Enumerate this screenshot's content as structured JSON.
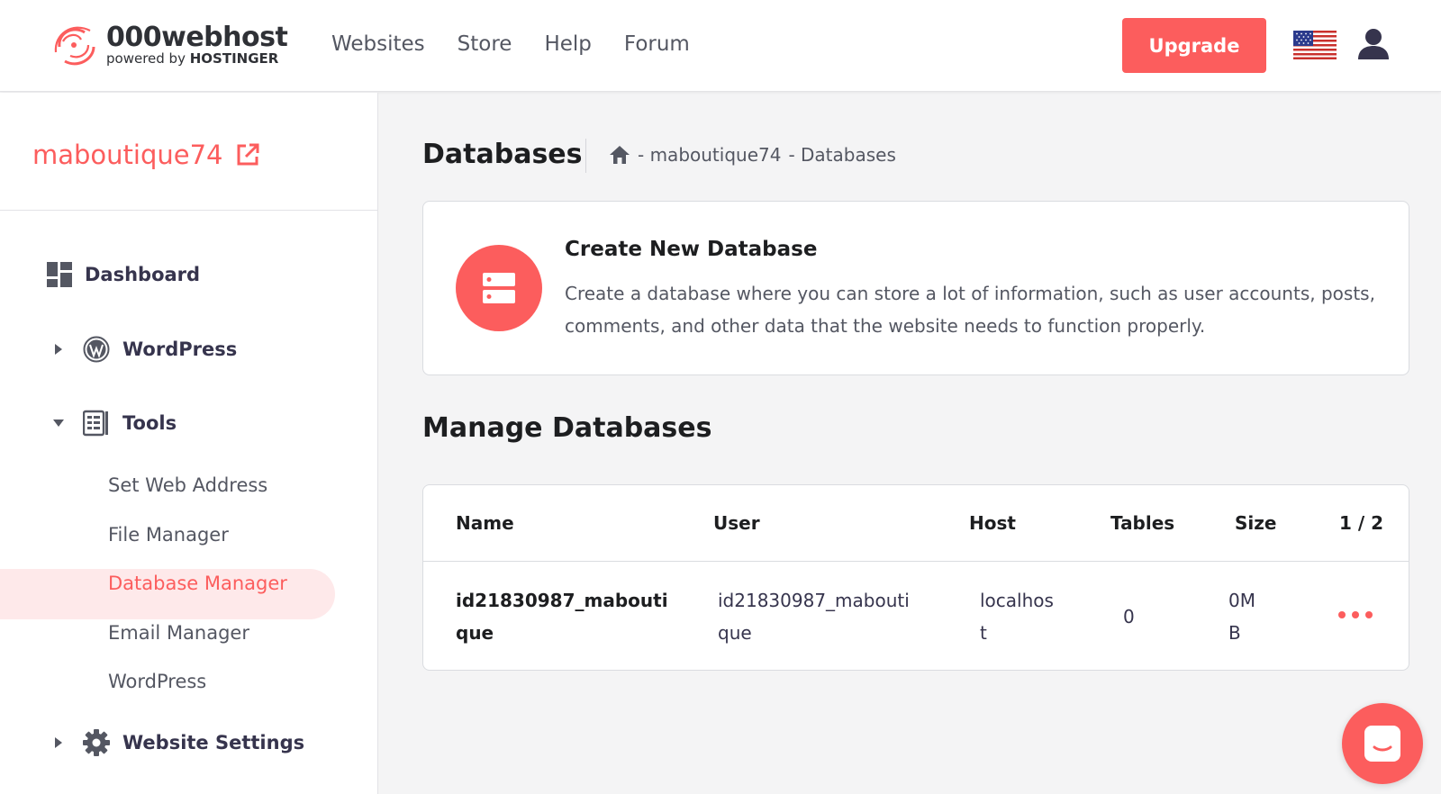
{
  "brand": {
    "name": "000webhost",
    "sub_prefix": "powered by",
    "sub_brand": "HOSTINGER"
  },
  "nav": {
    "items": [
      "Websites",
      "Store",
      "Help",
      "Forum"
    ]
  },
  "header": {
    "upgrade_label": "Upgrade",
    "flag_icon": "us-flag-icon",
    "user_icon": "user-icon"
  },
  "sidebar": {
    "site_name": "maboutique74",
    "items": [
      {
        "label": "Dashboard",
        "icon": "dashboard-icon"
      },
      {
        "label": "WordPress",
        "icon": "wordpress-icon",
        "expanded": false
      },
      {
        "label": "Tools",
        "icon": "tools-icon",
        "expanded": true
      },
      {
        "label": "Website Settings",
        "icon": "gear-icon",
        "expanded": false
      }
    ],
    "tools_sub": [
      {
        "label": "Set Web Address"
      },
      {
        "label": "File Manager"
      },
      {
        "label": "Database Manager",
        "active": true
      },
      {
        "label": "Email Manager"
      },
      {
        "label": "WordPress"
      }
    ]
  },
  "page": {
    "title": "Databases",
    "breadcrumb": [
      "- maboutique74",
      "- Databases"
    ]
  },
  "create": {
    "title": "Create New Database",
    "description": "Create a database where you can store a lot of information, such as user accounts, posts, comments, and other data that the website needs to function properly."
  },
  "manage": {
    "title": "Manage Databases",
    "columns": [
      "Name",
      "User",
      "Host",
      "Tables",
      "Size",
      "1 / 2"
    ],
    "rows": [
      {
        "name_1": "id21830987_mabouti",
        "name_2": "que",
        "user_1": "id21830987_mabouti",
        "user_2": "que",
        "host_1": "localhos",
        "host_2": "t",
        "tables": "0",
        "size_1": "0M",
        "size_2": "B"
      }
    ]
  },
  "colors": {
    "accent": "#fc5d5d",
    "active_bg": "#fee9ea",
    "text": "#1d1e20",
    "muted": "#545762"
  }
}
